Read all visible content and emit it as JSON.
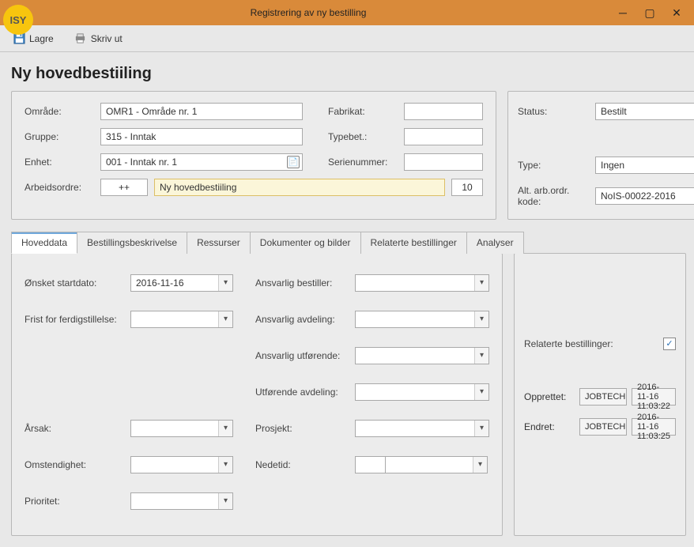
{
  "window": {
    "title": "Registrering av ny bestilling",
    "logo": "ISY"
  },
  "toolbar": {
    "save_label": "Lagre",
    "print_label": "Skriv ut"
  },
  "page_heading": "Ny hovedbestiiling",
  "header": {
    "omrade_lbl": "Område:",
    "omrade_val": "OMR1 - Område nr. 1",
    "gruppe_lbl": "Gruppe:",
    "gruppe_val": "315 - Inntak",
    "enhet_lbl": "Enhet:",
    "enhet_val": "001 - Inntak nr. 1",
    "fabrikat_lbl": "Fabrikat:",
    "typebet_lbl": "Typebet.:",
    "serienummer_lbl": "Serienummer:",
    "arbeidsordre_lbl": "Arbeidsordre:",
    "arbeidsordre_plus": "++",
    "arbeidsordre_text": "Ny hovedbestiiling",
    "arbeidsordre_num": "10"
  },
  "status_panel": {
    "status_lbl": "Status:",
    "status_val": "Bestilt",
    "type_lbl": "Type:",
    "type_val": "Ingen",
    "alt_lbl": "Alt. arb.ordr. kode:",
    "alt_val": "NoIS-00022-2016"
  },
  "tabs": {
    "hoveddata": "Hoveddata",
    "bestillingsbeskrivelse": "Bestillingsbeskrivelse",
    "ressurser": "Ressurser",
    "dokumenter": "Dokumenter og bilder",
    "relaterte": "Relaterte bestillinger",
    "analyser": "Analyser"
  },
  "hovedform": {
    "onsket_lbl": "Ønsket startdato:",
    "onsket_val": "2016-11-16",
    "frist_lbl": "Frist for ferdigstillelse:",
    "ansvarlig_bestiller_lbl": "Ansvarlig bestiller:",
    "ansvarlig_avdeling_lbl": "Ansvarlig avdeling:",
    "ansvarlig_utforende_lbl": "Ansvarlig utførende:",
    "utforende_avdeling_lbl": "Utførende avdeling:",
    "arsak_lbl": "Årsak:",
    "prosjekt_lbl": "Prosjekt:",
    "omstendighet_lbl": "Omstendighet:",
    "nedetid_lbl": "Nedetid:",
    "prioritet_lbl": "Prioritet:"
  },
  "side": {
    "relaterte_lbl": "Relaterte bestillinger:",
    "relaterte_checked": "✓",
    "opprettet_lbl": "Opprettet:",
    "opprettet_user": "JOBTECH",
    "opprettet_ts": "2016-11-16 11:03:22",
    "endret_lbl": "Endret:",
    "endret_user": "JOBTECH",
    "endret_ts": "2016-11-16 11:03:25"
  }
}
